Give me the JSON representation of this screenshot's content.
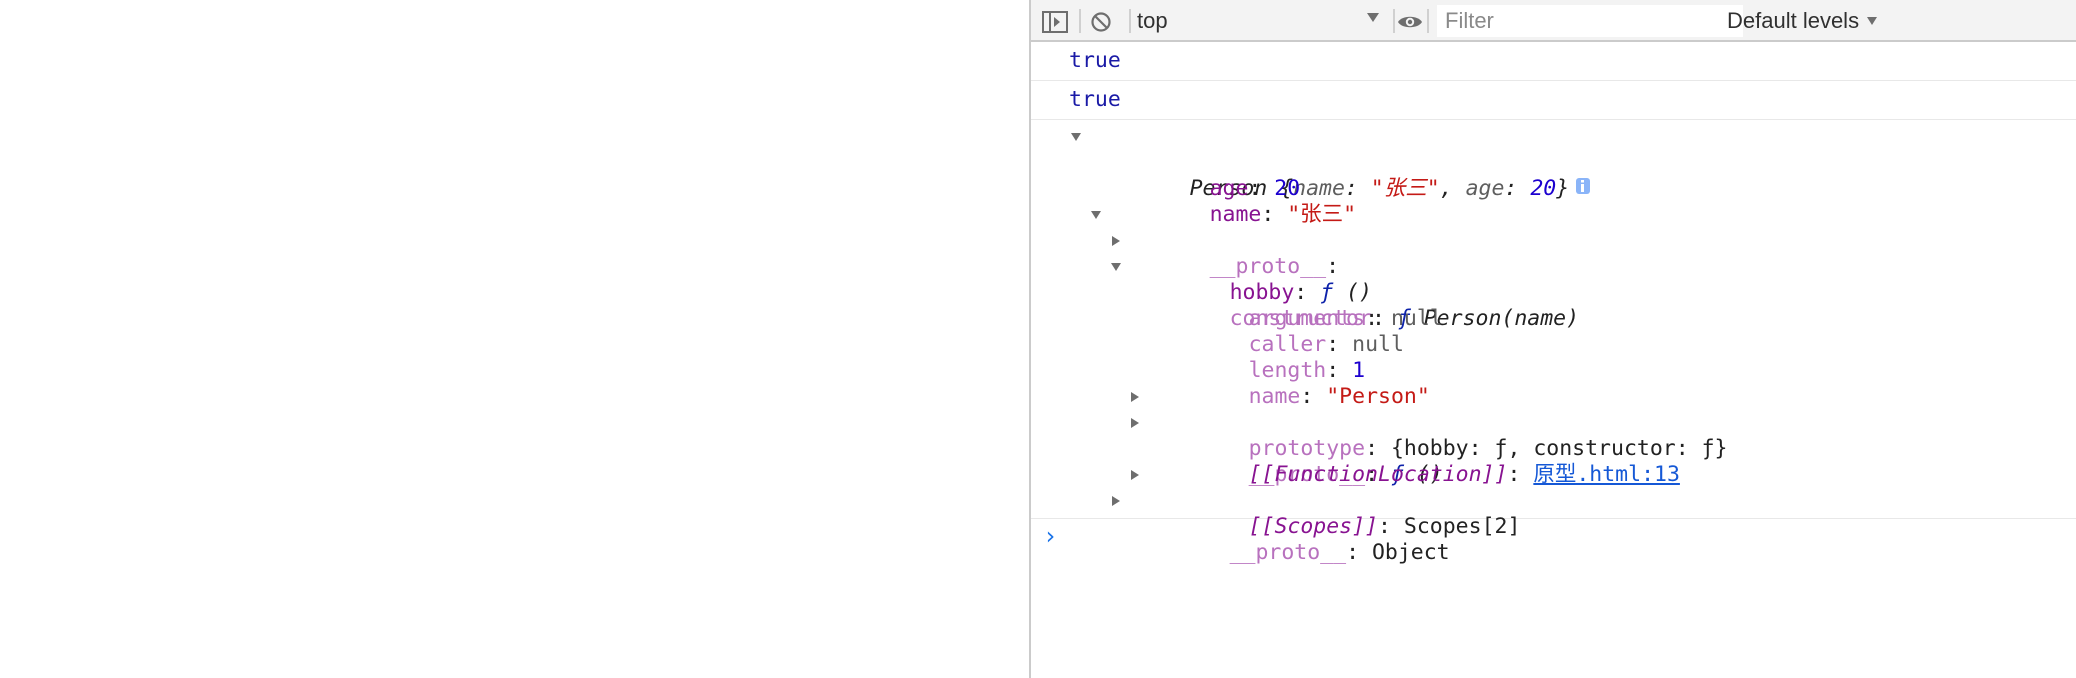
{
  "toolbar": {
    "context": "top",
    "filter_placeholder": "Filter",
    "levels": "Default levels"
  },
  "console": {
    "logs": [
      "true",
      "true"
    ],
    "object": {
      "summary": {
        "class": "Person",
        "open": " {",
        "k1": "name",
        "v1": "\"张三\"",
        "k2": "age",
        "v2": "20",
        "close": "}"
      },
      "age": {
        "key": "age",
        "value": "20"
      },
      "name": {
        "key": "name",
        "value": "\"张三\""
      },
      "proto": {
        "key": "__proto__",
        "colon": ":"
      },
      "hobby": {
        "key": "hobby",
        "f": "ƒ",
        "sig": " ()"
      },
      "constructor": {
        "key": "constructor",
        "f": "ƒ",
        "sig": " Person(name)"
      },
      "arguments": {
        "key": "arguments",
        "value": "null"
      },
      "caller": {
        "key": "caller",
        "value": "null"
      },
      "length": {
        "key": "length",
        "value": "1"
      },
      "fname": {
        "key": "name",
        "value": "\"Person\""
      },
      "prototype": {
        "key": "prototype",
        "value": "{hobby: ƒ, constructor: ƒ}"
      },
      "fproto": {
        "key": "__proto__",
        "f": "ƒ",
        "sig": " ()"
      },
      "location": {
        "key": "[[FunctionLocation]]",
        "link": "原型.html:13"
      },
      "scopes": {
        "key": "[[Scopes]]",
        "value": "Scopes[2]"
      },
      "objproto": {
        "key": "__proto__",
        "value": "Object"
      }
    },
    "prompt": "›"
  },
  "colors": {
    "accent": "#1a73e8",
    "string": "#c41a16",
    "number": "#1c00cf",
    "key": "#881391"
  }
}
